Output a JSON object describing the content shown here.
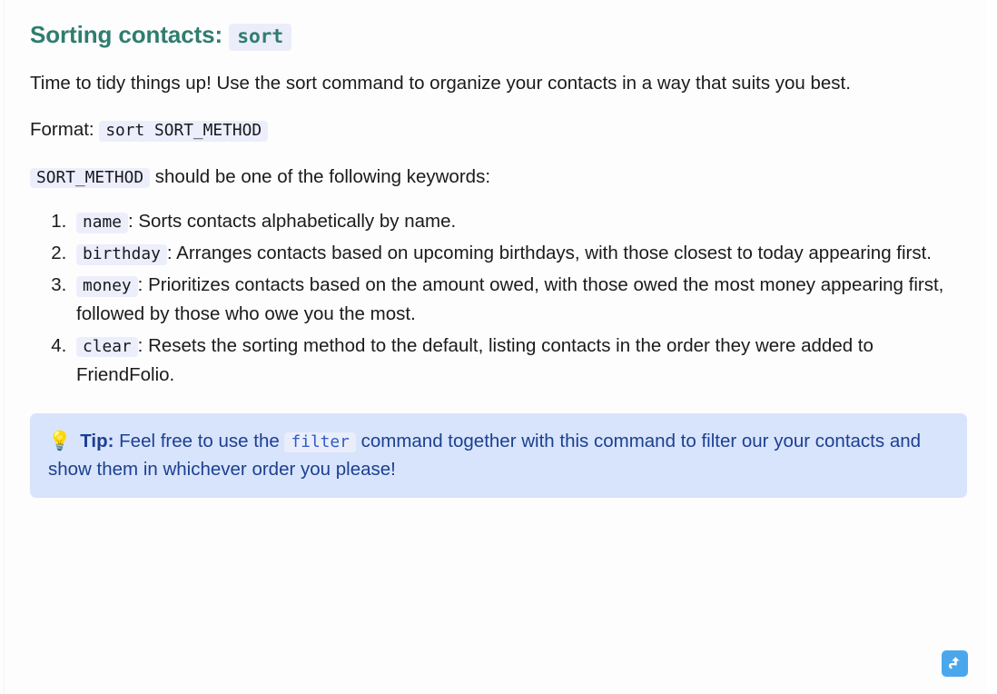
{
  "page": {
    "heading_prefix": "Sorting contacts:",
    "heading_code": "sort",
    "intro": "Time to tidy things up! Use the sort command to organize your contacts in a way that suits you best.",
    "format_label": "Format:",
    "format_code": "sort SORT_METHOD",
    "keyword_intro_code": "SORT_METHOD",
    "keyword_intro_text": "should be one of the following keywords:"
  },
  "keywords": [
    {
      "code": "name",
      "separator": ":",
      "description": "Sorts contacts alphabetically by name."
    },
    {
      "code": "birthday",
      "separator": ":",
      "description": "Arranges contacts based on upcoming birthdays, with those closest to today appearing first."
    },
    {
      "code": "money",
      "separator": ":",
      "description": "Prioritizes contacts based on the amount owed, with those owed the most money appearing first, followed by those who owe you the most."
    },
    {
      "code": "clear",
      "separator": ":",
      "description": "Resets the sorting method to the default, listing contacts in the order they were added to FriendFolio."
    }
  ],
  "tip": {
    "icon": "💡",
    "label": "Tip:",
    "text_before": "Feel free to use the",
    "code": "filter",
    "text_after": "command together with this command to filter our your contacts and show them in whichever order you please!"
  },
  "scroll_top": {
    "label": "Back to top"
  },
  "colors": {
    "heading": "#2f7d70",
    "code_bg": "#edeefb",
    "tip_bg": "#d8e4fb",
    "tip_text": "#1c3f91",
    "scroll_button": "#4aa7ec"
  }
}
